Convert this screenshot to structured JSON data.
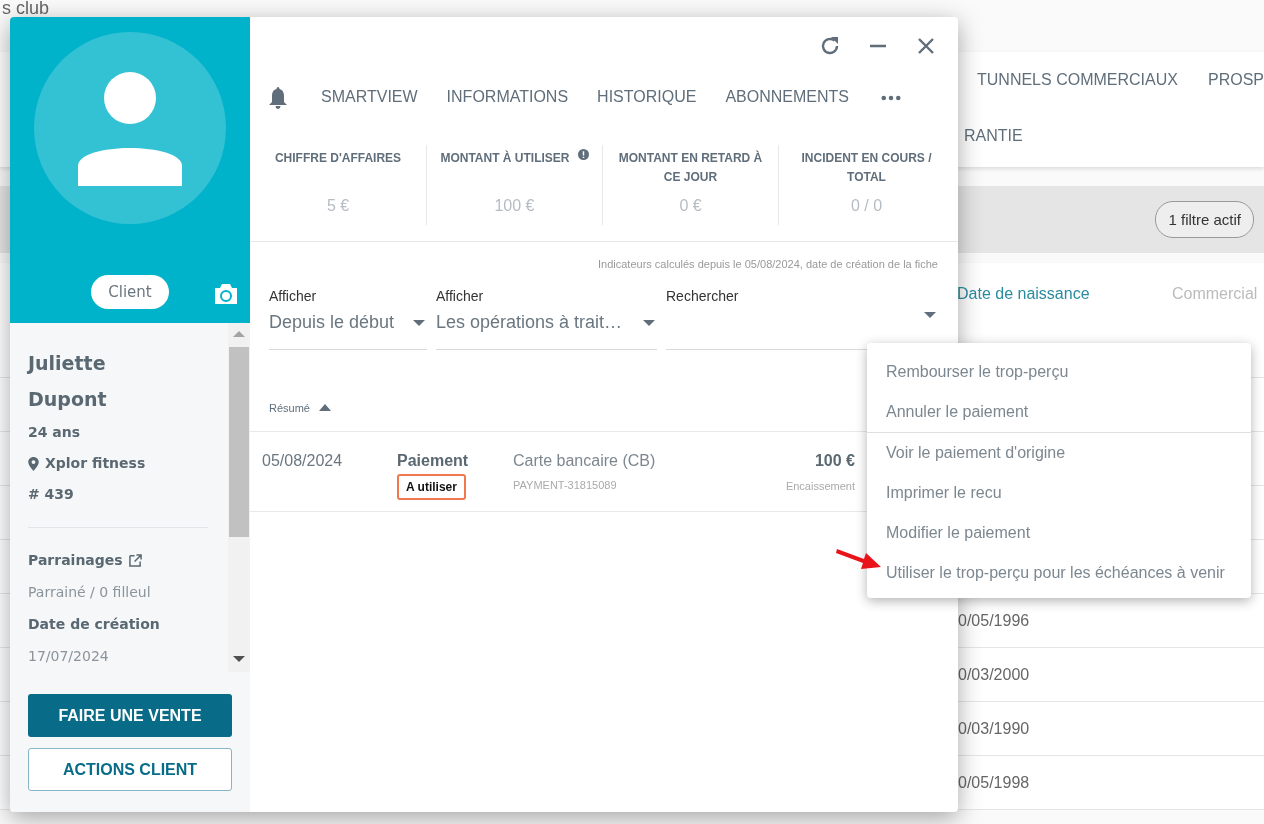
{
  "background_page": {
    "title": "s club",
    "nav_row_1": [
      "TUNNELS COMMERCIAUX",
      "PROSP"
    ],
    "nav_row_2": [
      "RANTIE"
    ],
    "filter_bar": {
      "filter_button": "1 filtre actif"
    },
    "table": {
      "columns": [
        "Date de naissance",
        "Commercial"
      ],
      "rows": [
        "0/05/1996",
        "0/03/2000",
        "0/03/1990",
        "0/05/1998"
      ]
    }
  },
  "client_panel": {
    "badge": "Client",
    "first_name": "Juliette",
    "last_name": "Dupont",
    "age": "24 ans",
    "location": "Xplor fitness",
    "member_number": "# 439",
    "sponsorship_label": "Parrainages",
    "sponsorship_value": "Parrainé / 0 filleul",
    "creation_label": "Date de création",
    "creation_date": "17/07/2024",
    "buttons": [
      {
        "label": "FAIRE UNE VENTE",
        "kind": "primary"
      },
      {
        "label": "ACTIONS CLIENT",
        "kind": "outline"
      }
    ]
  },
  "tabs": [
    {
      "label": "SMARTVIEW",
      "selected": false
    },
    {
      "label": "INFORMATIONS",
      "selected": false
    },
    {
      "label": "HISTORIQUE",
      "selected": false
    },
    {
      "label": "ABONNEMENTS",
      "selected": false
    }
  ],
  "indicators": [
    {
      "label": "CHIFFRE D'AFFAIRES",
      "value": "5 €",
      "info": false
    },
    {
      "label": "MONTANT À UTILISER",
      "value": "100 €",
      "info": true
    },
    {
      "label": "MONTANT EN RETARD À CE JOUR",
      "value": "0 €",
      "info": false
    },
    {
      "label": "INCIDENT EN COURS / TOTAL",
      "value": "0 / 0",
      "info": false
    }
  ],
  "indicators_note": "Indicateurs calculés depuis le 05/08/2024, date de création de la fiche",
  "filters": [
    {
      "label": "Afficher",
      "value": "Depuis le début"
    },
    {
      "label": "Afficher",
      "value": "Les opérations à trait…"
    },
    {
      "label": "Rechercher"
    }
  ],
  "operations": {
    "sort_column": "Résumé",
    "rows": [
      {
        "date": "05/08/2024",
        "type": "Paiement",
        "tag": "A utiliser",
        "method": "Carte bancaire (CB)",
        "reference": "PAYMENT-31815089",
        "amount": "100 €",
        "status": "Encaissement"
      }
    ]
  },
  "context_menu": {
    "groups": [
      [
        "Rembourser le trop-perçu",
        "Annuler le paiement"
      ],
      [
        "Voir le paiement d'origine",
        "Imprimer le recu",
        "Modifier le paiement",
        "Utiliser le trop-perçu pour les échéances à venir"
      ]
    ]
  }
}
